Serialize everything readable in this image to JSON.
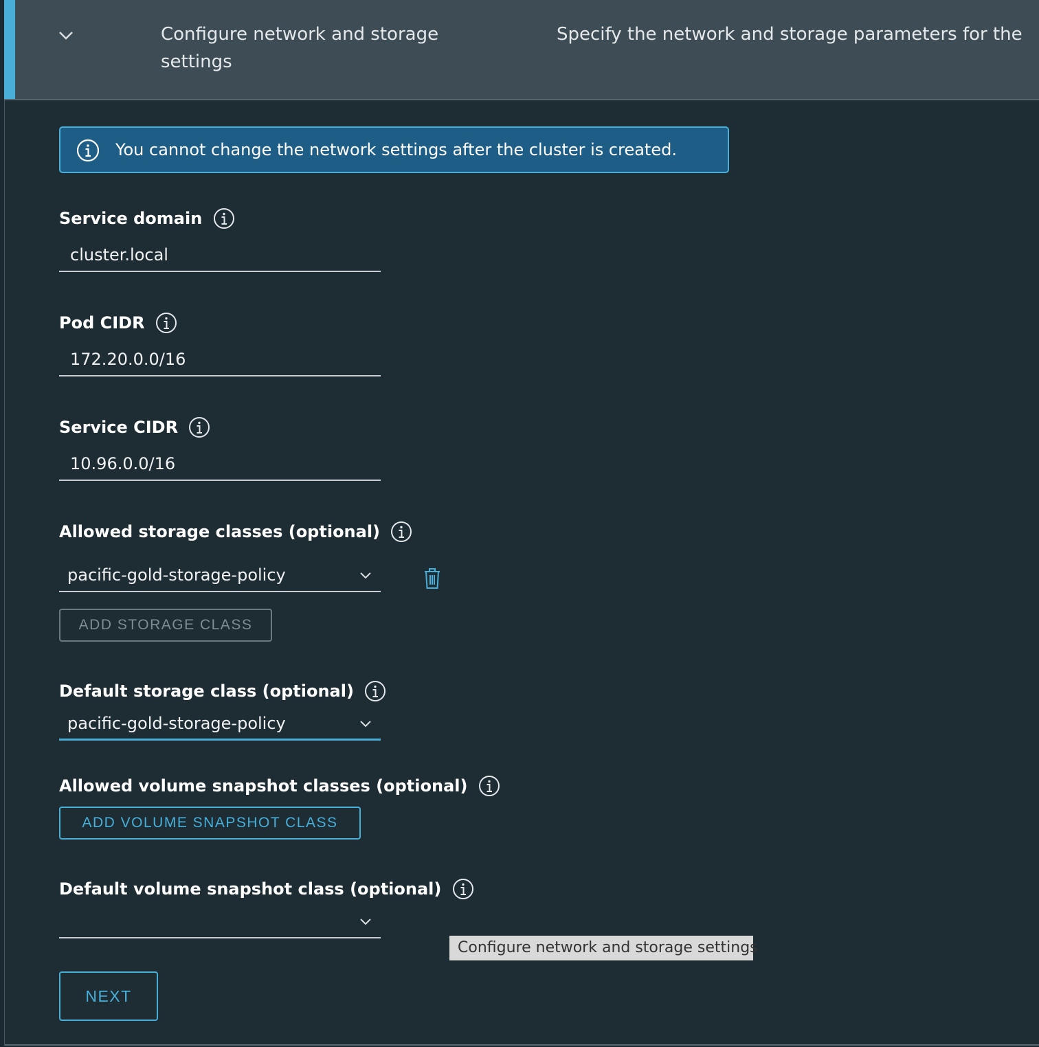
{
  "step": {
    "title": "Configure network and storage settings",
    "description": "Specify the network and storage parameters for the"
  },
  "alert": {
    "text": "You cannot change the network settings after the cluster is created."
  },
  "fields": {
    "service_domain": {
      "label": "Service domain",
      "value": "cluster.local"
    },
    "pod_cidr": {
      "label": "Pod CIDR",
      "value": "172.20.0.0/16"
    },
    "service_cidr": {
      "label": "Service CIDR",
      "value": "10.96.0.0/16"
    },
    "allowed_storage": {
      "label": "Allowed storage classes (optional)",
      "value": "pacific-gold-storage-policy",
      "add_button": "ADD STORAGE CLASS"
    },
    "default_storage": {
      "label": "Default storage class (optional)",
      "value": "pacific-gold-storage-policy"
    },
    "allowed_snapshot": {
      "label": "Allowed volume snapshot classes (optional)",
      "add_button": "ADD VOLUME SNAPSHOT CLASS"
    },
    "default_snapshot": {
      "label": "Default volume snapshot class (optional)",
      "value": ""
    }
  },
  "tooltip": "Configure network and storage settings",
  "next_button": "NEXT",
  "colors": {
    "accent": "#49afd9",
    "header_bg": "#3e4d55",
    "page_bg": "#1e2c34",
    "alert_bg": "#1d5d86"
  }
}
